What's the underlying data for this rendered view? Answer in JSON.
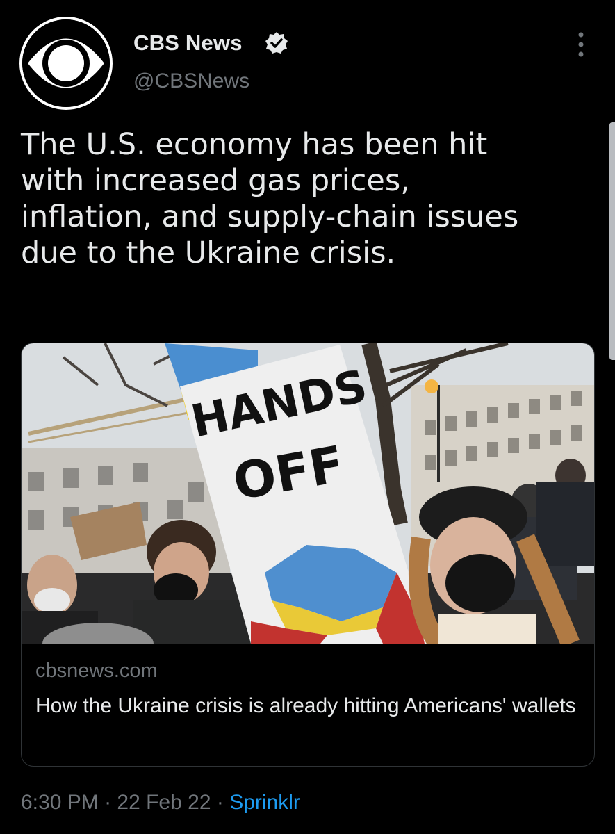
{
  "author": {
    "name": "CBS News",
    "handle": "@CBSNews",
    "verified": true,
    "avatar_icon": "cbs-eye-logo",
    "more_icon": "more-vertical-icon"
  },
  "tweet": {
    "text": "The U.S. economy has been hit\nwith increased gas prices,\ninflation, and supply-chain issues\ndue to the Ukraine crisis."
  },
  "card": {
    "image_alt": "Protesters holding a HANDS OFF sign with Ukraine map",
    "sign_line1": "HANDS",
    "sign_line2": "OFF",
    "domain": "cbsnews.com",
    "title": "How the Ukraine crisis is already hitting Americans' wallets"
  },
  "meta": {
    "time": "6:30 PM",
    "separator": " · ",
    "date": "22 Feb 22",
    "source": "Sprinklr"
  },
  "colors": {
    "background": "#000000",
    "text": "#e7e9ea",
    "secondary": "#71767b",
    "link": "#1d9bf0",
    "border": "#2f3336"
  }
}
